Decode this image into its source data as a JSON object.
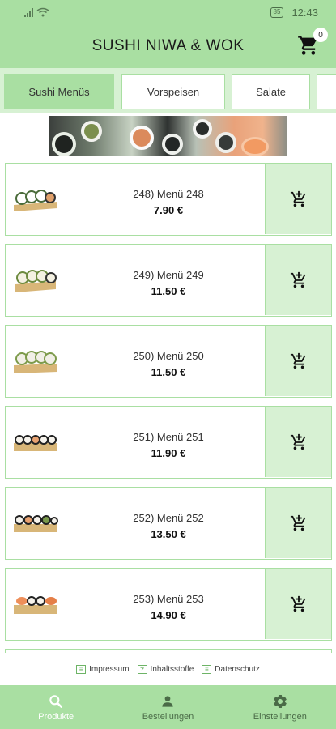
{
  "status_bar": {
    "time": "12:43",
    "battery": "85"
  },
  "header": {
    "title": "SUSHI NIWA & WOK",
    "cart_count": "0"
  },
  "tabs": [
    {
      "label": "Sushi Menüs",
      "active": true
    },
    {
      "label": "Vorspeisen",
      "active": false
    },
    {
      "label": "Salate",
      "active": false
    },
    {
      "label": "",
      "active": false
    }
  ],
  "products": [
    {
      "name": "248) Menü 248",
      "price": "7.90 €"
    },
    {
      "name": "249) Menü 249",
      "price": "11.50 €"
    },
    {
      "name": "250) Menü 250",
      "price": "11.50 €"
    },
    {
      "name": "251) Menü 251",
      "price": "11.90 €"
    },
    {
      "name": "252) Menü 252",
      "price": "13.50 €"
    },
    {
      "name": "253) Menü 253",
      "price": "14.90 €"
    }
  ],
  "footer_links": {
    "impressum": "Impressum",
    "inhaltsstoffe": "Inhaltsstoffe",
    "datenschutz": "Datenschutz"
  },
  "bottom_nav": {
    "produkte": "Produkte",
    "bestellungen": "Bestellungen",
    "einstellungen": "Einstellungen"
  },
  "colors": {
    "primary": "#a9dfa2",
    "light": "#d7f1d3"
  }
}
